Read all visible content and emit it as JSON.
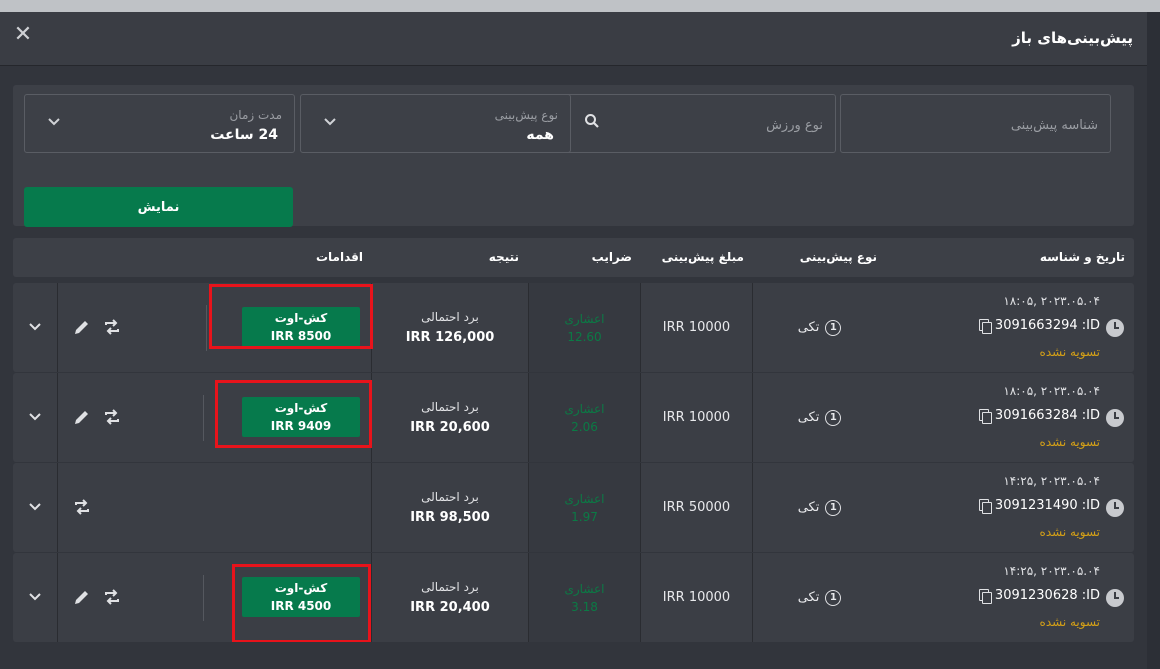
{
  "modal": {
    "title": "پیش‌بینی‌های باز",
    "close_label": "✕"
  },
  "filters": {
    "bet_id_placeholder": "شناسه پیش‌بینی",
    "sport_placeholder": "نوع ورزش",
    "bet_type_label": "نوع پیش‌بینی",
    "bet_type_value": "همه",
    "duration_label": "مدت زمان",
    "duration_value": "24 ساعت",
    "show_button": "نمایش"
  },
  "columns": {
    "date_id": "تاریخ و شناسه",
    "bet_type": "نوع پیش‌بینی",
    "amount": "مبلغ پیش‌بینی",
    "odds": "ضرایب",
    "result": "نتیجه",
    "actions": "اقدامات"
  },
  "rows": [
    {
      "date": "۲۰۲۳.۰۵.۰۴ ,۱۸:۰۵",
      "id": "3091663294 :ID",
      "status": "تسویه نشده",
      "type_icon": "1",
      "type": "تکی",
      "amount": "IRR 10000",
      "odds_label": "اعشاری",
      "odds_value": "12.60",
      "result_label": "برد احتمالی",
      "result_value": "IRR 126,000",
      "cashout_label": "کش-اوت",
      "cashout_value": "IRR 8500"
    },
    {
      "date": "۲۰۲۳.۰۵.۰۴ ,۱۸:۰۵",
      "id": "3091663284 :ID",
      "status": "تسویه نشده",
      "type_icon": "1",
      "type": "تکی",
      "amount": "IRR 10000",
      "odds_label": "اعشاری",
      "odds_value": "2.06",
      "result_label": "برد احتمالی",
      "result_value": "IRR 20,600",
      "cashout_label": "کش-اوت",
      "cashout_value": "IRR 9409"
    },
    {
      "date": "۲۰۲۳.۰۵.۰۴ ,۱۴:۲۵",
      "id": "3091231490 :ID",
      "status": "تسویه نشده",
      "type_icon": "1",
      "type": "تکی",
      "amount": "IRR 50000",
      "odds_label": "اعشاری",
      "odds_value": "1.97",
      "result_label": "برد احتمالی",
      "result_value": "IRR 98,500"
    },
    {
      "date": "۲۰۲۳.۰۵.۰۴ ,۱۴:۲۵",
      "id": "3091230628 :ID",
      "status": "تسویه نشده",
      "type_icon": "1",
      "type": "تکی",
      "amount": "IRR 10000",
      "odds_label": "اعشاری",
      "odds_value": "3.18",
      "result_label": "برد احتمالی",
      "result_value": "IRR 20,400",
      "cashout_label": "کش-اوت",
      "cashout_value": "IRR 4500"
    }
  ],
  "colors": {
    "accent_green": "#067a4c",
    "odds_green": "#0b7a45",
    "status_amber": "#d4a017",
    "highlight_red": "#e8131b"
  }
}
